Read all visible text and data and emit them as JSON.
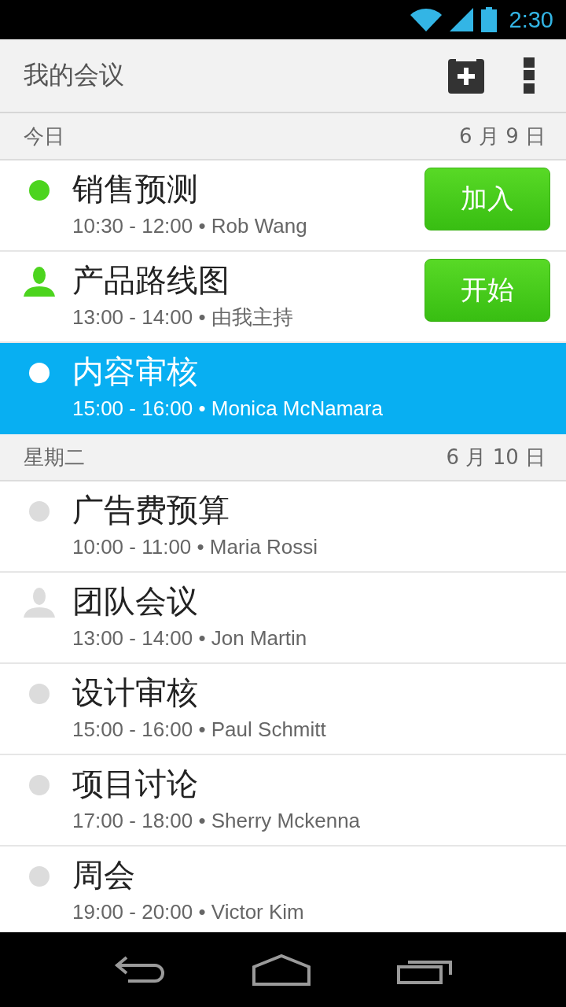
{
  "status_bar": {
    "time": "2:30"
  },
  "app_bar": {
    "title": "我的会议"
  },
  "sections": [
    {
      "label": "今日",
      "date": "6 月 9 日",
      "meetings": [
        {
          "kind": "dot",
          "active": true,
          "selected": false,
          "title": "销售预测",
          "details": "10:30 - 12:00 • Rob Wang",
          "action": "加入"
        },
        {
          "kind": "person",
          "active": true,
          "selected": false,
          "title": "产品路线图",
          "details": "13:00 - 14:00 • 由我主持",
          "action": "开始"
        },
        {
          "kind": "dot",
          "active": false,
          "selected": true,
          "title": "内容审核",
          "details": "15:00 - 16:00 • Monica McNamara"
        }
      ]
    },
    {
      "label": "星期二",
      "date": "6 月 10 日",
      "meetings": [
        {
          "kind": "dot",
          "active": false,
          "selected": false,
          "title": "广告费预算",
          "details": "10:00 - 11:00 • Maria Rossi"
        },
        {
          "kind": "person",
          "active": false,
          "selected": false,
          "title": "团队会议",
          "details": "13:00 - 14:00 • Jon Martin"
        },
        {
          "kind": "dot",
          "active": false,
          "selected": false,
          "title": "设计审核",
          "details": "15:00 - 16:00 • Paul Schmitt"
        },
        {
          "kind": "dot",
          "active": false,
          "selected": false,
          "title": "项目讨论",
          "details": "17:00 - 18:00 • Sherry Mckenna"
        },
        {
          "kind": "dot",
          "active": false,
          "selected": false,
          "title": "周会",
          "details": "19:00 - 20:00 • Victor Kim"
        }
      ]
    }
  ]
}
